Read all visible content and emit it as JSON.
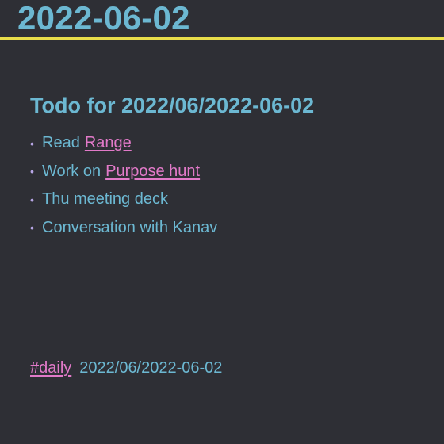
{
  "page": {
    "title": "2022-06-02"
  },
  "todo": {
    "heading": "Todo for 2022/06/2022-06-02",
    "items": [
      {
        "text": "Read",
        "link": "Range"
      },
      {
        "text": "Work on",
        "link": "Purpose hunt"
      },
      {
        "text": "Thu meeting deck"
      },
      {
        "text": "Conversation with Kanav"
      }
    ]
  },
  "footer": {
    "tag": "#daily",
    "date": "2022/06/2022-06-02"
  },
  "colors": {
    "background": "#2e2f35",
    "heading": "#6cb8d2",
    "link": "#e27ac9",
    "bullet": "#b7a6e6",
    "title_underline": "#e8dd4a"
  }
}
